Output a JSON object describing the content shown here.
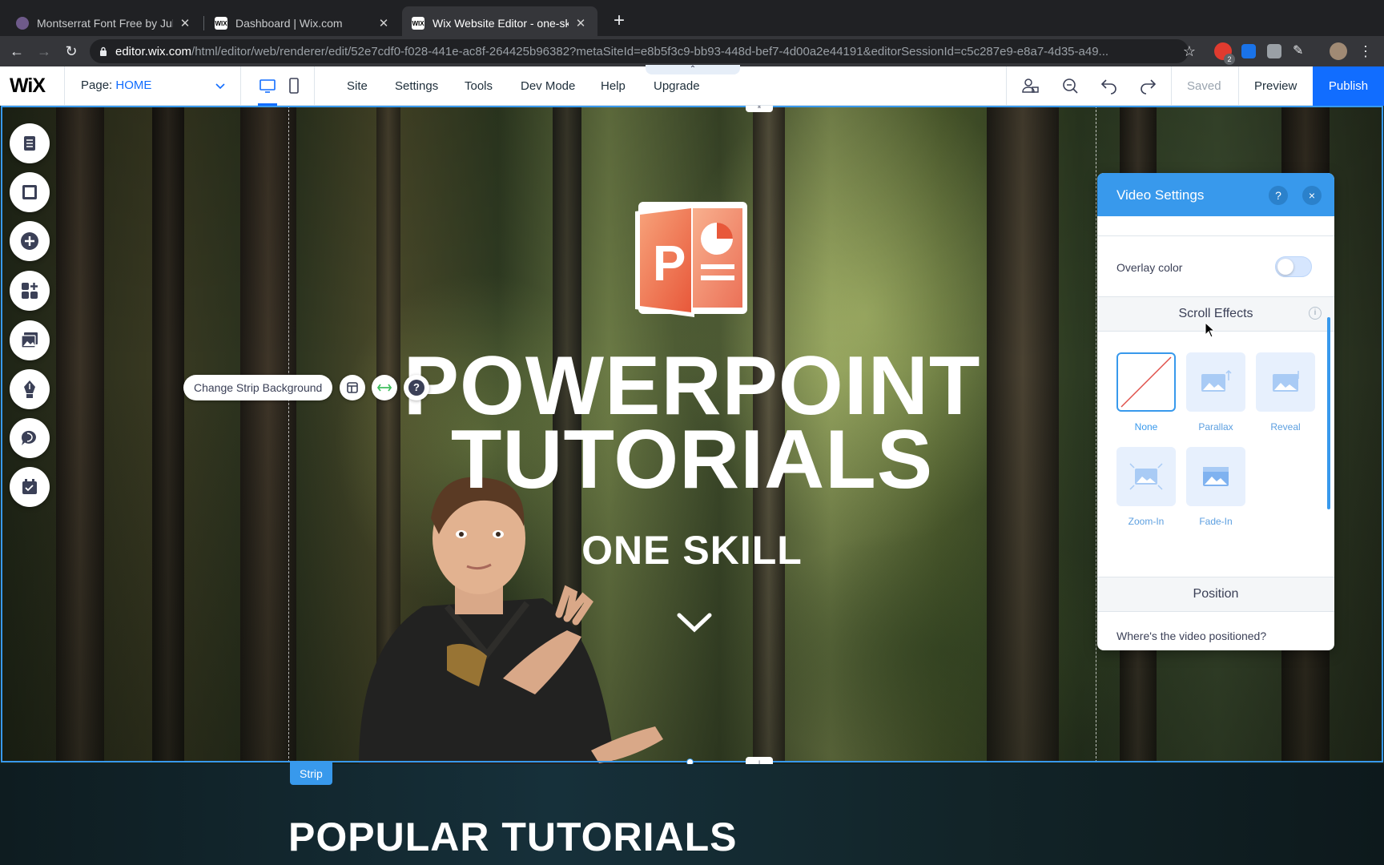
{
  "browser": {
    "tabs": [
      {
        "title": "Montserrat Font Free by Juliet",
        "active": false
      },
      {
        "title": "Dashboard | Wix.com",
        "active": false
      },
      {
        "title": "Wix Website Editor - one-skill",
        "active": true
      }
    ],
    "url_domain": "editor.wix.com",
    "url_rest": "/html/editor/web/renderer/edit/52e7cdf0-f028-441e-ac8f-264425b96382?metaSiteId=e8b5f3c9-bb93-448d-bef7-4d00a2e44191&editorSessionId=c5c287e9-e8a7-4d35-a49...",
    "extension_badge": "2"
  },
  "editor": {
    "logo": "WiX",
    "page_label": "Page:",
    "page_value": "HOME",
    "menu": [
      "Site",
      "Settings",
      "Tools",
      "Dev Mode",
      "Help",
      "Upgrade"
    ],
    "saved_label": "Saved",
    "preview_label": "Preview",
    "publish_label": "Publish",
    "accent": "#116dff"
  },
  "stage": {
    "headline_line1": "POWERPOINT",
    "headline_line2": "TUTORIALS",
    "subheadline": "ONE SKILL",
    "strip_tag": "Strip",
    "change_bg_label": "Change Strip Background",
    "help_glyph": "?",
    "next_section_title": "POPULAR TUTORIALS"
  },
  "left_tools": [
    "pages-icon",
    "layout-icon",
    "add-icon",
    "apps-icon",
    "media-icon",
    "blog-pen-icon",
    "chat-icon",
    "bookings-icon"
  ],
  "video_settings": {
    "title": "Video Settings",
    "help_label": "?",
    "close_label": "×",
    "overlay_label": "Overlay color",
    "overlay_on": false,
    "scroll_effects_title": "Scroll Effects",
    "info_label": "i",
    "effects": [
      {
        "label": "None",
        "selected": true
      },
      {
        "label": "Parallax",
        "selected": false
      },
      {
        "label": "Reveal",
        "selected": false
      },
      {
        "label": "Zoom-In",
        "selected": false
      },
      {
        "label": "Fade-In",
        "selected": false
      }
    ],
    "position_title": "Position",
    "position_question": "Where's the video positioned?"
  }
}
